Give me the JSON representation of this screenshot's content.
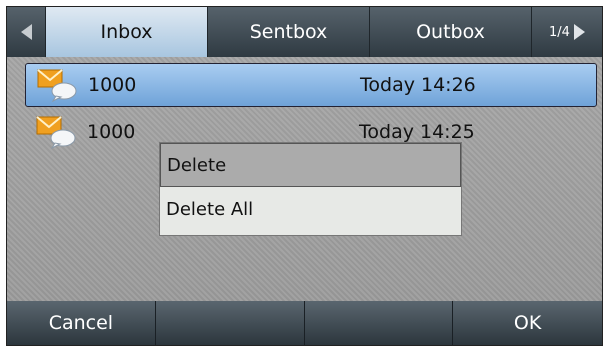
{
  "tabs": [
    {
      "label": "Inbox"
    },
    {
      "label": "Sentbox"
    },
    {
      "label": "Outbox"
    }
  ],
  "page_indicator": "1/4",
  "messages": [
    {
      "number": "1000",
      "time": "Today 14:26",
      "selected": true
    },
    {
      "number": "1000",
      "time": "Today 14:25",
      "selected": false
    }
  ],
  "menu": {
    "items": [
      {
        "label": "Delete"
      },
      {
        "label": "Delete All"
      }
    ]
  },
  "softkeys": [
    {
      "label": "Cancel"
    },
    {
      "label": ""
    },
    {
      "label": ""
    },
    {
      "label": "OK"
    }
  ],
  "colors": {
    "selected_row": "#6fa3d8",
    "menu_highlight": "#ababab",
    "envelope": "#f0a020"
  }
}
